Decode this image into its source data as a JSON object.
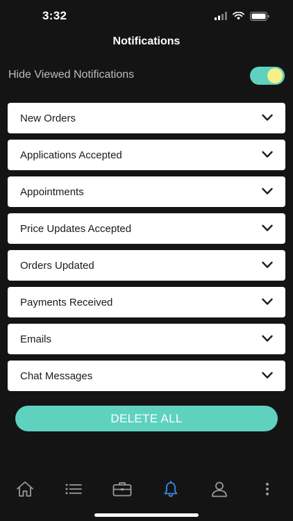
{
  "status_bar": {
    "time": "3:32"
  },
  "header": {
    "title": "Notifications"
  },
  "hide_viewed": {
    "label": "Hide Viewed Notifications",
    "enabled": true
  },
  "sections": [
    {
      "label": "New Orders"
    },
    {
      "label": "Applications Accepted"
    },
    {
      "label": "Appointments"
    },
    {
      "label": "Price Updates Accepted"
    },
    {
      "label": "Orders Updated"
    },
    {
      "label": "Payments Received"
    },
    {
      "label": "Emails"
    },
    {
      "label": "Chat Messages"
    }
  ],
  "actions": {
    "delete_all_label": "DELETE ALL"
  },
  "tab_bar": {
    "items": [
      {
        "icon": "home-icon",
        "active": false
      },
      {
        "icon": "list-icon",
        "active": false
      },
      {
        "icon": "briefcase-icon",
        "active": false
      },
      {
        "icon": "bell-icon",
        "active": true
      },
      {
        "icon": "person-icon",
        "active": false
      },
      {
        "icon": "more-vertical-icon",
        "active": false
      }
    ]
  },
  "colors": {
    "background": "#141414",
    "accent": "#5fd2bf",
    "toggle_knob": "#f5f08a",
    "active_tab": "#3a8ef0",
    "inactive_tab": "#9a9a9a"
  }
}
